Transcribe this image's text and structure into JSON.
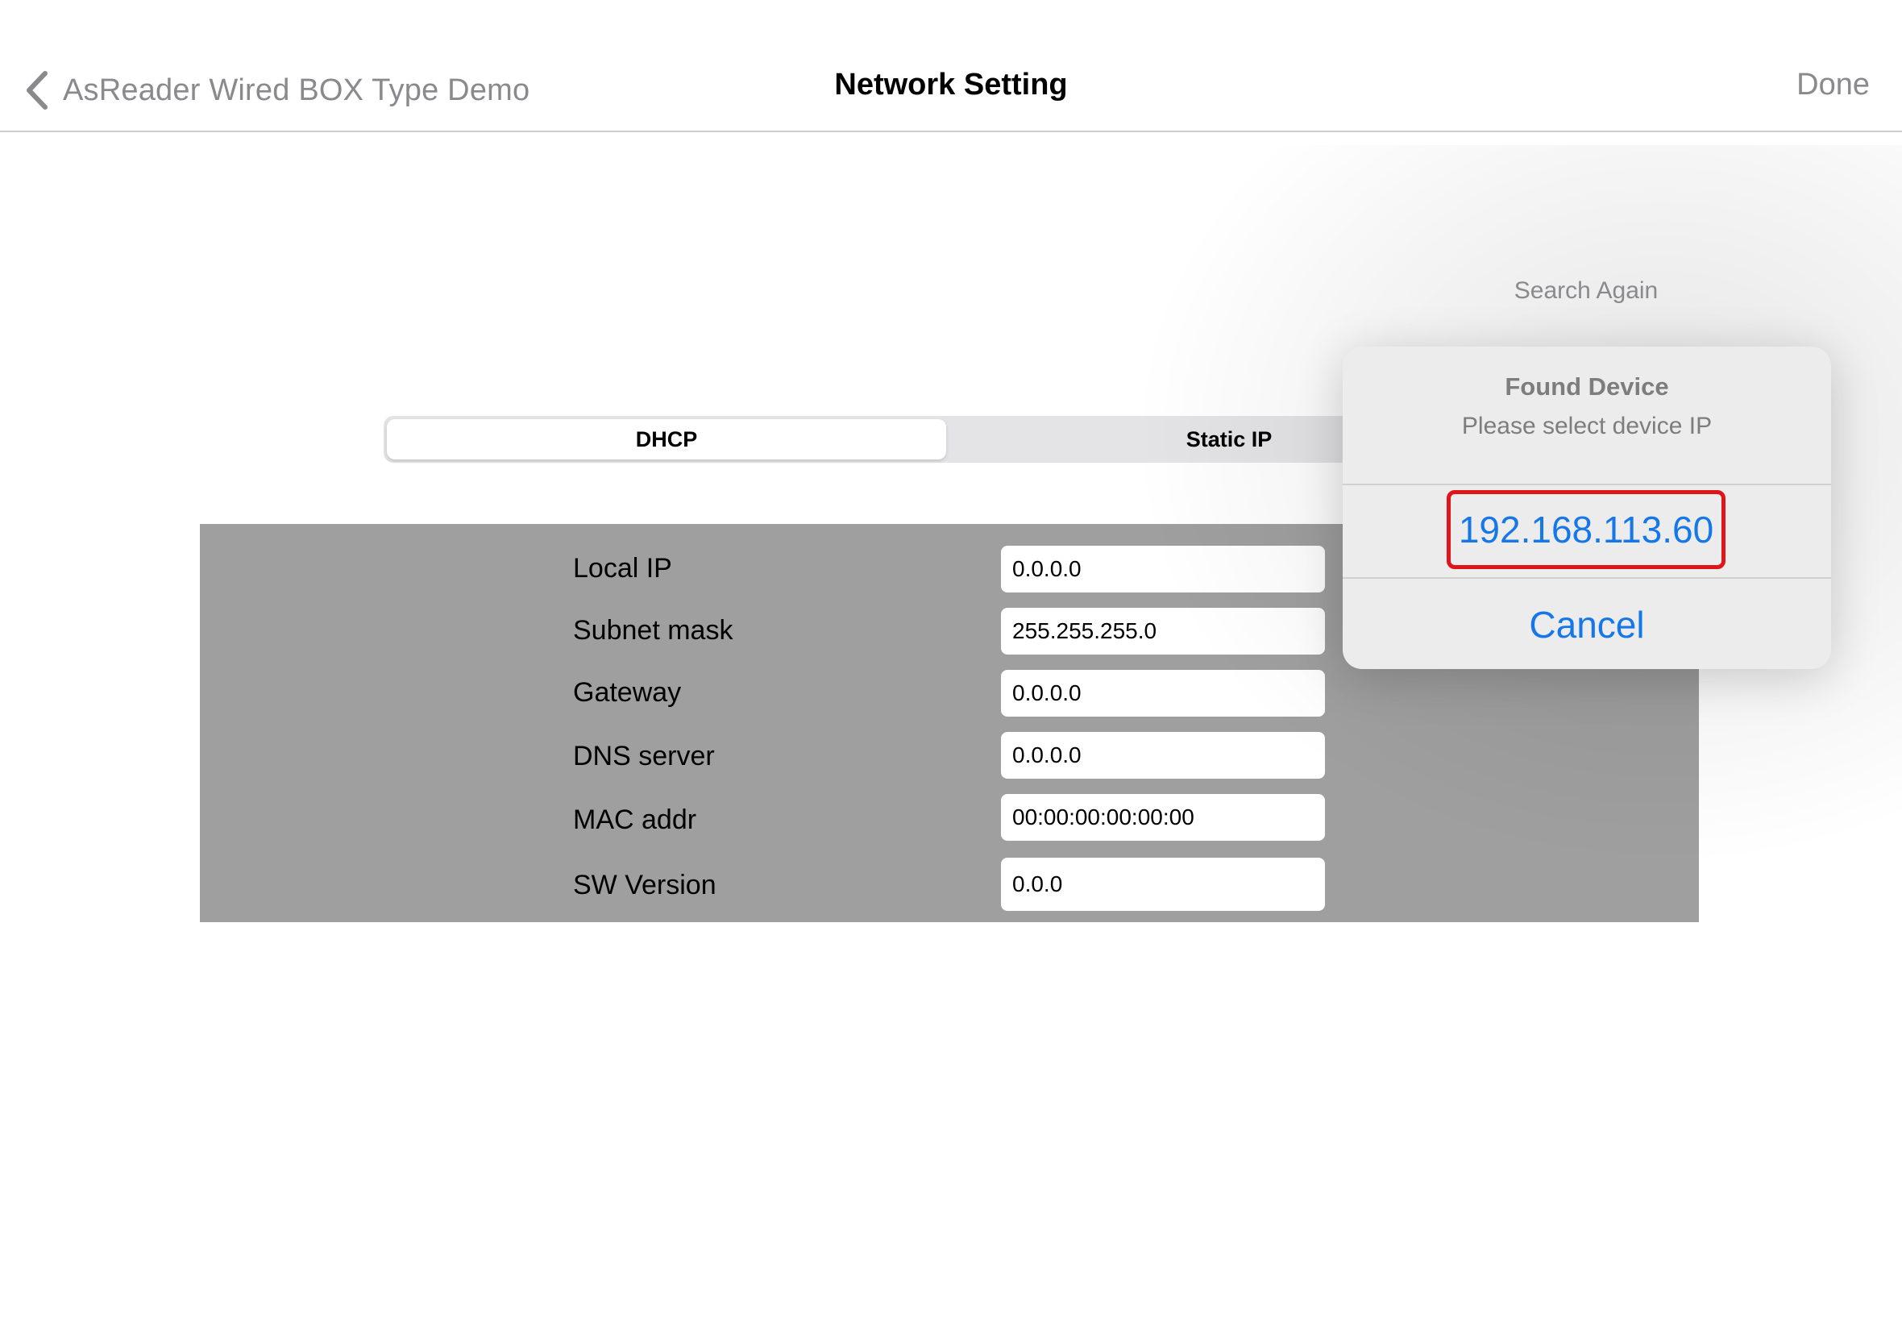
{
  "nav": {
    "back_label": "AsReader Wired BOX Type Demo",
    "title": "Network Setting",
    "done_label": "Done"
  },
  "segmented": {
    "options": [
      "DHCP",
      "Static IP"
    ],
    "selected": "DHCP"
  },
  "settings": {
    "rows": [
      {
        "label": "Local IP",
        "value": "0.0.0.0"
      },
      {
        "label": "Subnet mask",
        "value": "255.255.255.0"
      },
      {
        "label": "Gateway",
        "value": "0.0.0.0"
      },
      {
        "label": "DNS server",
        "value": "0.0.0.0"
      },
      {
        "label": "MAC addr",
        "value": "00:00:00:00:00:00"
      },
      {
        "label": "SW Version",
        "value": "0.0.0"
      }
    ]
  },
  "popover": {
    "anchor_label": "Search Again",
    "title": "Found Device",
    "message": "Please select device IP",
    "device_ip": "192.168.113.60",
    "cancel_label": "Cancel"
  },
  "colors": {
    "accent": "#1677e8",
    "highlight": "#e0151a",
    "panel": "#9f9f9f"
  },
  "icons": {
    "back": "chevron-left-icon"
  }
}
